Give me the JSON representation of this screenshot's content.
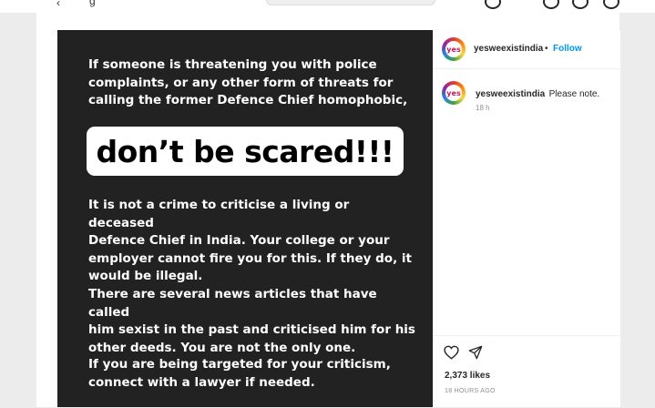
{
  "post": {
    "image": {
      "para1": "If someone is threatening you with police\ncomplaints, or any other form of threats for\ncalling the former Defence Chief homophobic,",
      "banner": "don’t be scared!!!",
      "para2": "It is not a crime to criticise a living or deceased\nDefence Chief in India. Your college or your\nemployer cannot fire you for this. If they do, it\nwould be illegal.",
      "para3": "There are several news articles that have called\nhim sexist in the past and criticised him for his\nother deeds. You are not the only one.",
      "para4": "If you are being targeted for your criticism,\nconnect with a lawyer if needed."
    },
    "header": {
      "username": "yesweexistindia",
      "separator": "•",
      "follow_label": "Follow"
    },
    "caption": {
      "username": "yesweexistindia",
      "text": "Please note.",
      "time": "18 h"
    },
    "likes": "2,373 likes",
    "posted_ago": "18 HOURS AGO",
    "avatar_initials": "yes"
  },
  "icons": {
    "like": "heart-icon",
    "share": "send-icon",
    "back": "chevron-left-icon"
  },
  "colors": {
    "image_bg": "#222222",
    "follow": "#0095f6",
    "muted": "#8e8e8e"
  }
}
